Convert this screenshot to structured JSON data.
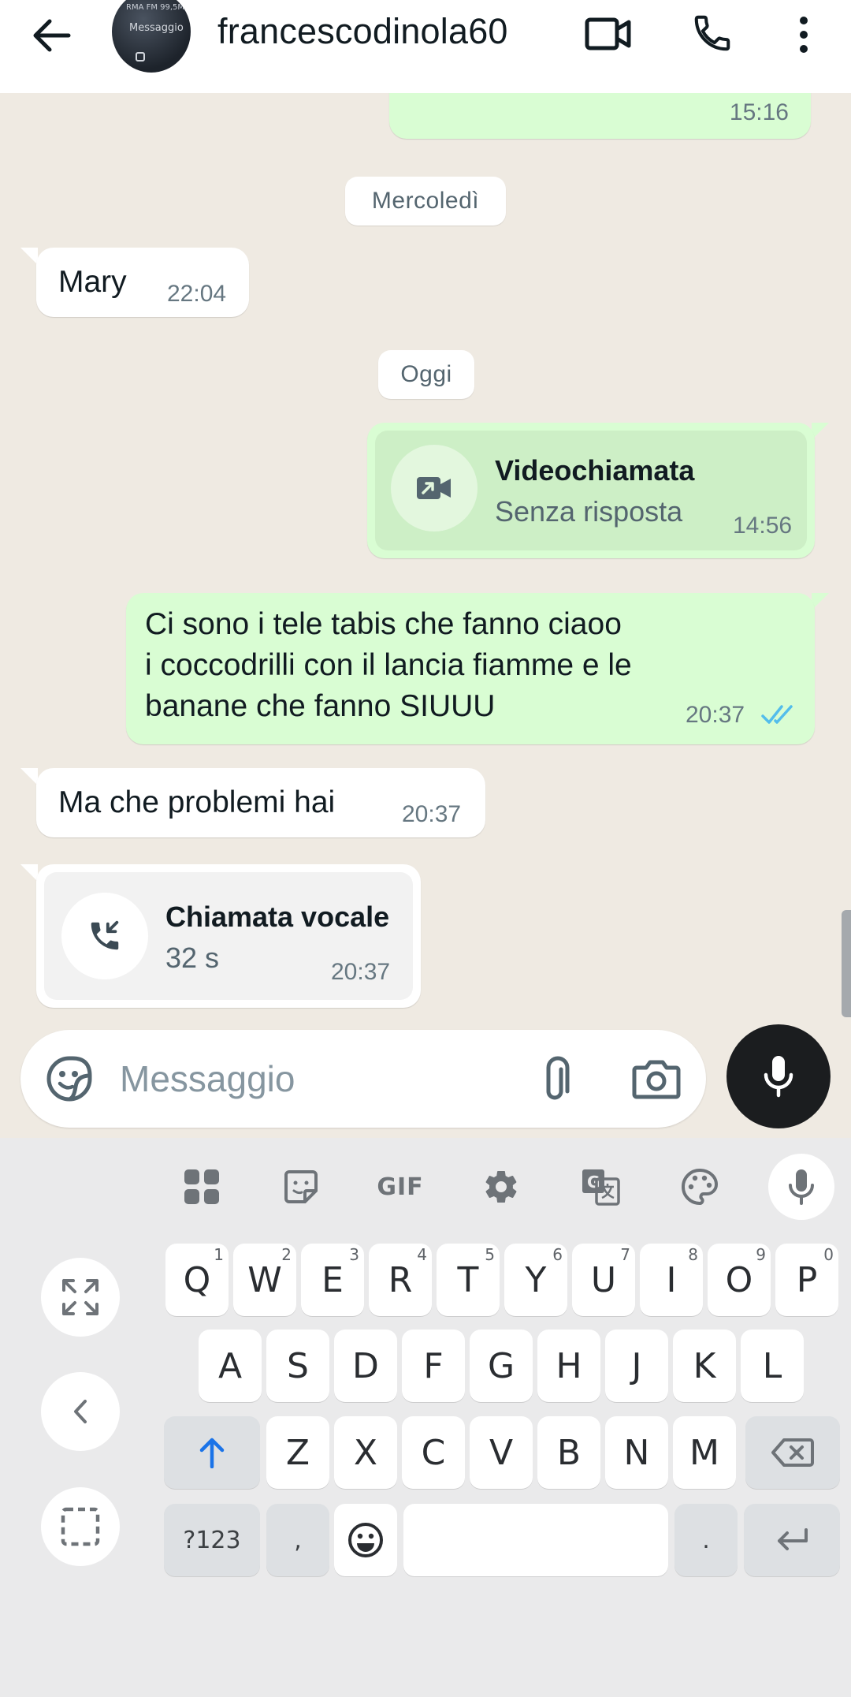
{
  "header": {
    "contact_name": "francescodinola60",
    "avatar_text_top": "RMA FM 99,5M",
    "avatar_text_mid": "Messaggio"
  },
  "chat": {
    "top_partial_time": "15:16",
    "date_separators": [
      "Mercoledì",
      "Oggi"
    ],
    "messages": [
      {
        "direction": "in",
        "text": "Mary",
        "time": "22:04"
      },
      {
        "direction": "out",
        "type": "call",
        "title": "Videochiamata",
        "subtitle": "Senza risposta",
        "time": "14:56"
      },
      {
        "direction": "out",
        "text_lines": [
          "Ci sono i tele tabis  che fanno ciaoo",
          "i coccodrilli con il lancia fiamme e le",
          "banane che fanno SIUUU"
        ],
        "time": "20:37",
        "status": "read"
      },
      {
        "direction": "in",
        "text": "Ma che problemi hai",
        "time": "20:37"
      },
      {
        "direction": "in",
        "type": "call",
        "title": "Chiamata vocale",
        "subtitle": "32 s",
        "time": "20:37"
      }
    ]
  },
  "composer": {
    "placeholder": "Messaggio"
  },
  "keyboard": {
    "toolbar": [
      "apps-grid-icon",
      "sticker-icon",
      "GIF",
      "settings-icon",
      "translate-icon",
      "palette-icon",
      "mic-icon"
    ],
    "gif_label": "GIF",
    "row1": [
      {
        "k": "Q",
        "h": "1"
      },
      {
        "k": "W",
        "h": "2"
      },
      {
        "k": "E",
        "h": "3"
      },
      {
        "k": "R",
        "h": "4"
      },
      {
        "k": "T",
        "h": "5"
      },
      {
        "k": "Y",
        "h": "6"
      },
      {
        "k": "U",
        "h": "7"
      },
      {
        "k": "I",
        "h": "8"
      },
      {
        "k": "O",
        "h": "9"
      },
      {
        "k": "P",
        "h": "0"
      }
    ],
    "row2": [
      "A",
      "S",
      "D",
      "F",
      "G",
      "H",
      "J",
      "K",
      "L"
    ],
    "row3": [
      "Z",
      "X",
      "C",
      "V",
      "B",
      "N",
      "M"
    ],
    "symbols_label": "?123",
    "comma_label": ",",
    "period_label": "."
  },
  "colors": {
    "chat_bg": "#efeae2",
    "outgoing_bubble": "#d9fdd3",
    "incoming_bubble": "#ffffff",
    "read_ticks": "#53bdeb",
    "shift_active": "#1a73e8"
  }
}
